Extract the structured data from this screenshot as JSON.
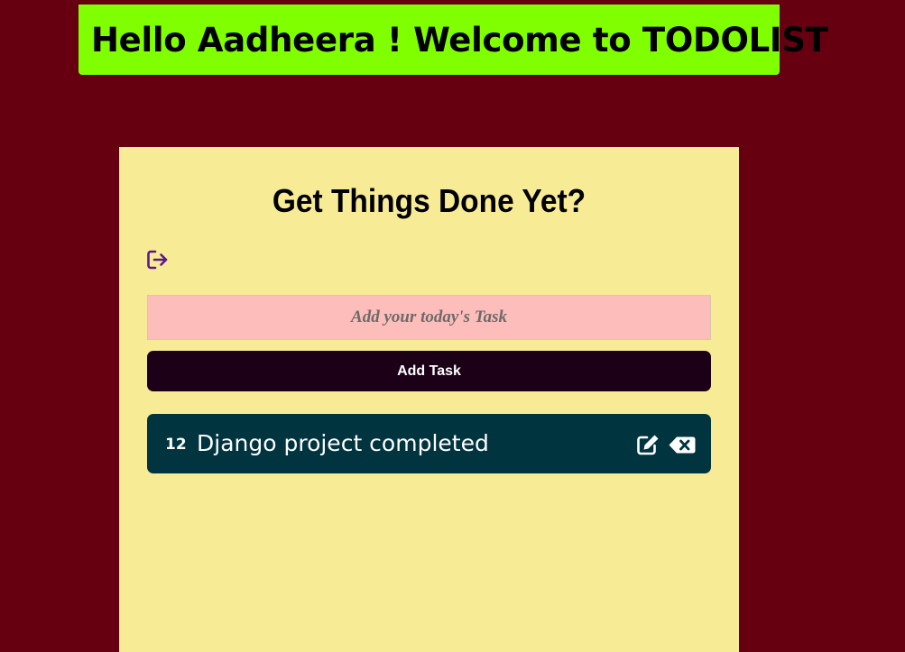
{
  "header": {
    "welcome_text": "Hello Aadheera ! Welcome to TODOLIST"
  },
  "card": {
    "title": "Get Things Done Yet?",
    "logout_icon": "sign-out-icon"
  },
  "form": {
    "placeholder": "Add your today's Task",
    "value": "",
    "submit_label": "Add Task"
  },
  "tasks": [
    {
      "id": "12",
      "text": "Django project completed",
      "edit_icon": "edit-icon",
      "delete_icon": "backspace-delete-icon"
    }
  ],
  "colors": {
    "background": "#660011",
    "banner": "#80ff00",
    "card": "#f7eb95",
    "input": "#fdbdba",
    "button": "#1c0018",
    "task": "#00343f",
    "icon_accent": "#5b1a8c"
  }
}
